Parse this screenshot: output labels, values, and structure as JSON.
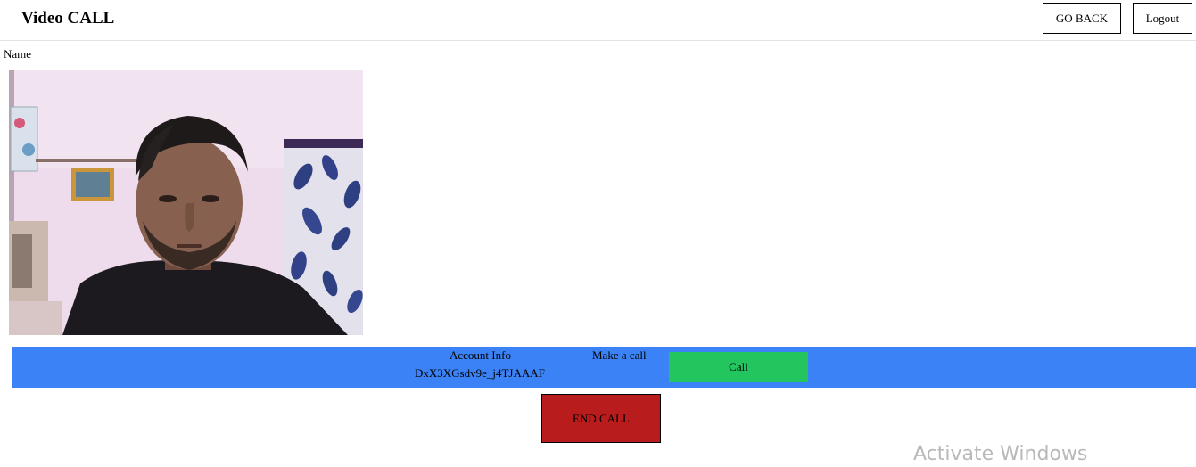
{
  "header": {
    "title": "Video CALL",
    "go_back_label": "GO BACK",
    "logout_label": "Logout"
  },
  "video": {
    "name_label": "Name"
  },
  "info_bar": {
    "account_info_label": "Account Info",
    "account_id": "DxX3XGsdv9e_j4TJAAAF",
    "make_call_label": "Make a call",
    "call_button_label": "Call"
  },
  "end_call_label": "END CALL",
  "watermark": "Activate Windows",
  "colors": {
    "info_bar": "#3b82f6",
    "call_button": "#22c55e",
    "end_call_button": "#b91c1c"
  }
}
